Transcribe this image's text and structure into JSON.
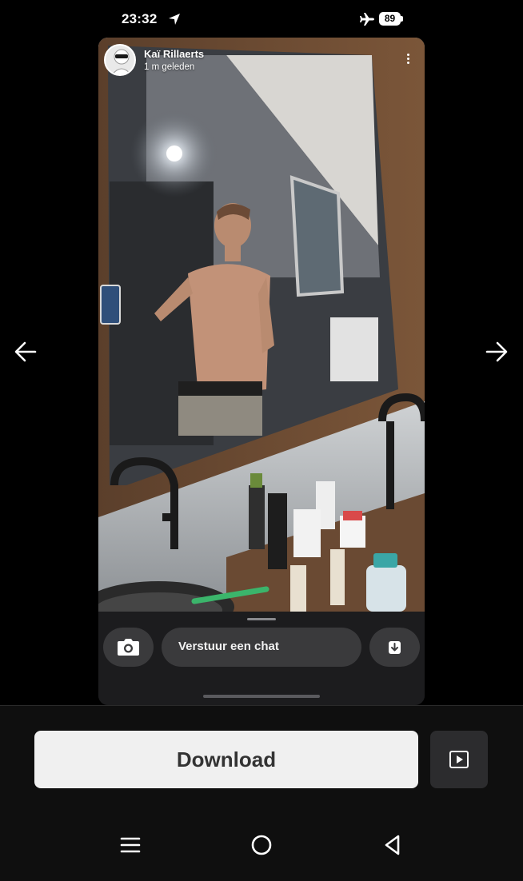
{
  "status_bar": {
    "time": "23:32",
    "battery": "89",
    "icons": [
      "location-arrow-icon",
      "airplane-icon",
      "battery-icon"
    ]
  },
  "story": {
    "user_name": "Kaï Rillaerts",
    "posted": "1 m geleden",
    "menu_icon": "kebab-menu-icon"
  },
  "reply_bar": {
    "camera_icon": "camera-icon",
    "chat_placeholder": "Verstuur een chat",
    "save_icon": "save-download-icon"
  },
  "bottom_bar": {
    "download_label": "Download",
    "play_icon": "play-square-icon"
  },
  "navigation": {
    "prev_icon": "arrow-left-icon",
    "next_icon": "arrow-right-icon",
    "system": [
      "menu-icon",
      "home-circle-icon",
      "back-triangle-icon"
    ]
  },
  "colors": {
    "background": "#000000",
    "reply_background": "#1c1c1e",
    "pill": "#3a3a3c",
    "download_button": "#f0f0f0"
  }
}
